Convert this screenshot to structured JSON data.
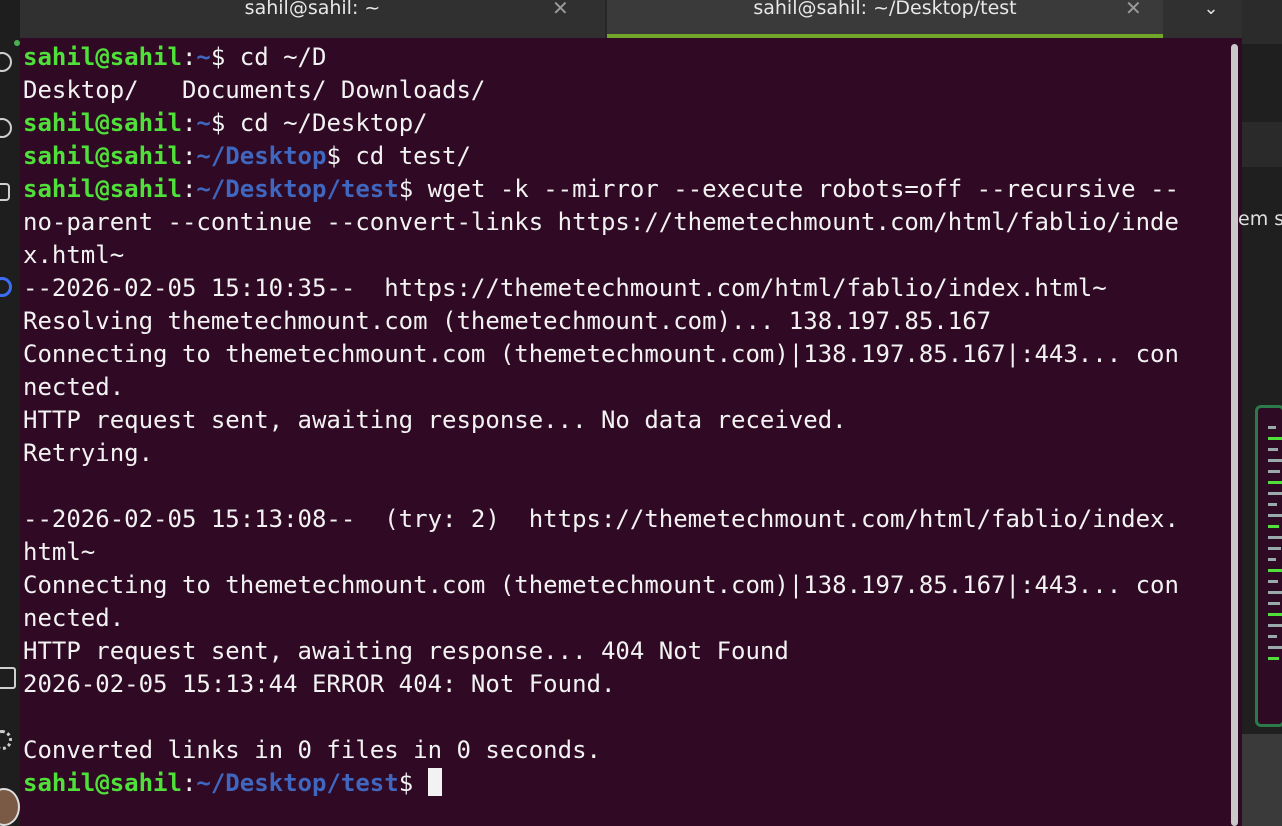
{
  "tabs": [
    {
      "title": "sahil@sahil: ~",
      "close": "✕",
      "active": false
    },
    {
      "title": "sahil@sahil: ~/Desktop/test",
      "close": "✕",
      "active": true
    }
  ],
  "tab_dropdown": "⌄",
  "colors": {
    "terminal_bg": "#300a24",
    "user_host": "#4fe03a",
    "path": "#3f67c0",
    "text": "#f2f2f2",
    "active_tab_indicator": "#71a62b"
  },
  "terminal": {
    "lines": [
      {
        "segs": [
          {
            "c": "u",
            "t": "sahil@sahil"
          },
          {
            "c": "w",
            "t": ":"
          },
          {
            "c": "p",
            "t": "~"
          },
          {
            "c": "w",
            "t": "$ cd ~/D"
          }
        ]
      },
      {
        "segs": [
          {
            "c": "w",
            "t": "Desktop/   Documents/ Downloads/"
          }
        ]
      },
      {
        "segs": [
          {
            "c": "u",
            "t": "sahil@sahil"
          },
          {
            "c": "w",
            "t": ":"
          },
          {
            "c": "p",
            "t": "~"
          },
          {
            "c": "w",
            "t": "$ cd ~/Desktop/"
          }
        ]
      },
      {
        "segs": [
          {
            "c": "u",
            "t": "sahil@sahil"
          },
          {
            "c": "w",
            "t": ":"
          },
          {
            "c": "p",
            "t": "~/Desktop"
          },
          {
            "c": "w",
            "t": "$ cd test/"
          }
        ]
      },
      {
        "segs": [
          {
            "c": "u",
            "t": "sahil@sahil"
          },
          {
            "c": "w",
            "t": ":"
          },
          {
            "c": "p",
            "t": "~/Desktop/test"
          },
          {
            "c": "w",
            "t": "$ wget -k --mirror --execute robots=off --recursive --"
          }
        ]
      },
      {
        "segs": [
          {
            "c": "w",
            "t": "no-parent --continue --convert-links https://themetechmount.com/html/fablio/inde"
          }
        ]
      },
      {
        "segs": [
          {
            "c": "w",
            "t": "x.html~"
          }
        ]
      },
      {
        "segs": [
          {
            "c": "w",
            "t": "--2026-02-05 15:10:35--  https://themetechmount.com/html/fablio/index.html~"
          }
        ]
      },
      {
        "segs": [
          {
            "c": "w",
            "t": "Resolving themetechmount.com (themetechmount.com)... 138.197.85.167"
          }
        ]
      },
      {
        "segs": [
          {
            "c": "w",
            "t": "Connecting to themetechmount.com (themetechmount.com)|138.197.85.167|:443... con"
          }
        ]
      },
      {
        "segs": [
          {
            "c": "w",
            "t": "nected."
          }
        ]
      },
      {
        "segs": [
          {
            "c": "w",
            "t": "HTTP request sent, awaiting response... No data received."
          }
        ]
      },
      {
        "segs": [
          {
            "c": "w",
            "t": "Retrying."
          }
        ]
      },
      {
        "segs": [
          {
            "c": "w",
            "t": ""
          }
        ]
      },
      {
        "segs": [
          {
            "c": "w",
            "t": "--2026-02-05 15:13:08--  (try: 2)  https://themetechmount.com/html/fablio/index."
          }
        ]
      },
      {
        "segs": [
          {
            "c": "w",
            "t": "html~"
          }
        ]
      },
      {
        "segs": [
          {
            "c": "w",
            "t": "Connecting to themetechmount.com (themetechmount.com)|138.197.85.167|:443... con"
          }
        ]
      },
      {
        "segs": [
          {
            "c": "w",
            "t": "nected."
          }
        ]
      },
      {
        "segs": [
          {
            "c": "w",
            "t": "HTTP request sent, awaiting response... 404 Not Found"
          }
        ]
      },
      {
        "segs": [
          {
            "c": "w",
            "t": "2026-02-05 15:13:44 ERROR 404: Not Found."
          }
        ]
      },
      {
        "segs": [
          {
            "c": "w",
            "t": ""
          }
        ]
      },
      {
        "segs": [
          {
            "c": "w",
            "t": "Converted links in 0 files in 0 seconds."
          }
        ]
      },
      {
        "segs": [
          {
            "c": "u",
            "t": "sahil@sahil"
          },
          {
            "c": "w",
            "t": ":"
          },
          {
            "c": "p",
            "t": "~/Desktop/test"
          },
          {
            "c": "w",
            "t": "$ "
          }
        ],
        "cursor": true
      }
    ]
  },
  "background_window": {
    "partial_text": "em s"
  },
  "dock": {
    "icons": [
      "chrome-icon",
      "disk-icon",
      "users-icon",
      "browser-icon",
      "monitor-icon",
      "settings-icon"
    ],
    "avatar": "avatar"
  }
}
